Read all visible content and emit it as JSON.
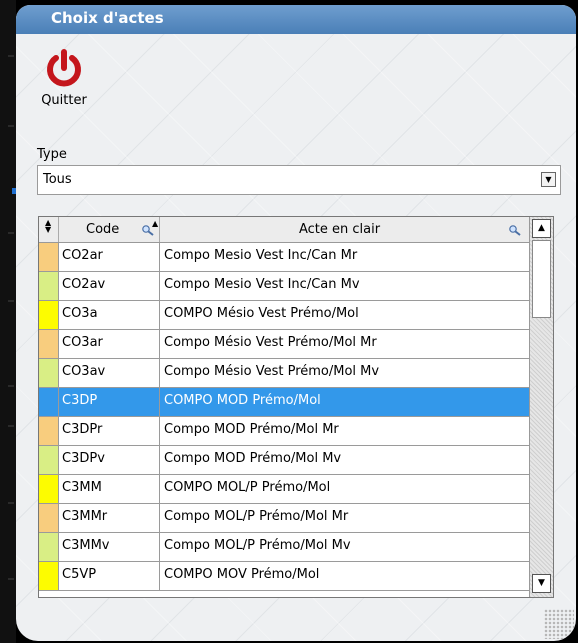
{
  "window": {
    "title": "Choix d'actes"
  },
  "toolbar": {
    "quit_label": "Quitter"
  },
  "type_filter": {
    "label": "Type",
    "value": "Tous"
  },
  "grid": {
    "columns": {
      "code": "Code",
      "acte": "Acte en clair"
    },
    "rows": [
      {
        "color": "#f8cd7e",
        "code": "CO2ar",
        "acte": "Compo Mesio Vest Inc/Can Mr",
        "selected": false
      },
      {
        "color": "#d9ee85",
        "code": "CO2av",
        "acte": "Compo Mesio Vest Inc/Can Mv",
        "selected": false
      },
      {
        "color": "#fdfc00",
        "code": "CO3a",
        "acte": "COMPO Mésio Vest Prémo/Mol",
        "selected": false
      },
      {
        "color": "#f8cd7e",
        "code": "CO3ar",
        "acte": "Compo Mésio Vest Prémo/Mol Mr",
        "selected": false
      },
      {
        "color": "#d9ee85",
        "code": "CO3av",
        "acte": "Compo Mésio Vest Prémo/Mol Mv",
        "selected": false
      },
      {
        "color": "#3398ea",
        "code": "C3DP",
        "acte": "COMPO MOD Prémo/Mol",
        "selected": true
      },
      {
        "color": "#f8cd7e",
        "code": "C3DPr",
        "acte": "Compo MOD Prémo/Mol Mr",
        "selected": false
      },
      {
        "color": "#d9ee85",
        "code": "C3DPv",
        "acte": "Compo MOD Prémo/Mol Mv",
        "selected": false
      },
      {
        "color": "#fdfc00",
        "code": "C3MM",
        "acte": "COMPO MOL/P Prémo/Mol",
        "selected": false
      },
      {
        "color": "#f8cd7e",
        "code": "C3MMr",
        "acte": "Compo MOL/P Prémo/Mol Mr",
        "selected": false
      },
      {
        "color": "#d9ee85",
        "code": "C3MMv",
        "acte": "Compo MOL/P Prémo/Mol Mv",
        "selected": false
      },
      {
        "color": "#fdfc00",
        "code": "C5VP",
        "acte": "COMPO MOV Prémo/Mol",
        "selected": false
      }
    ]
  },
  "colors": {
    "accent": "#3398ea",
    "title_bar": "#5a8cc2",
    "quit_icon": "#c4161c"
  }
}
